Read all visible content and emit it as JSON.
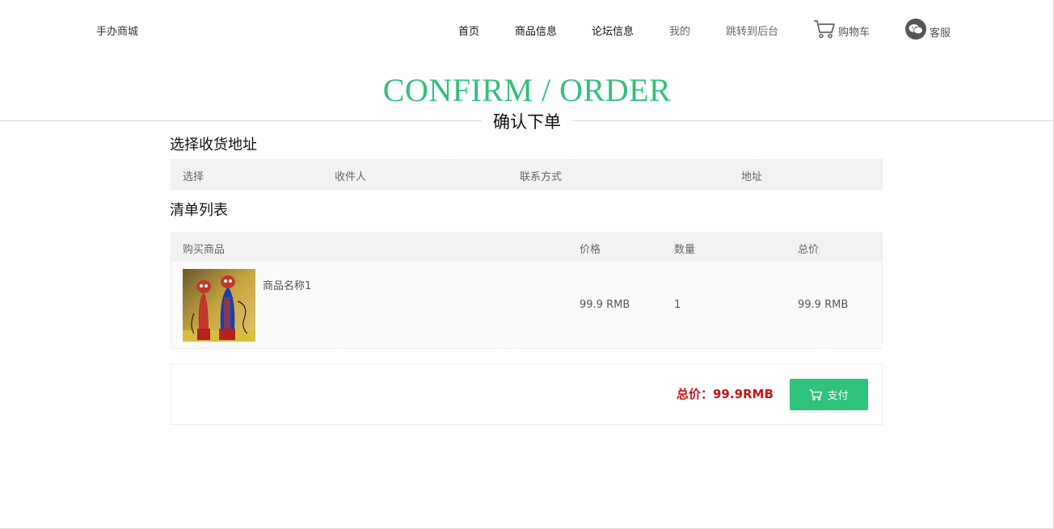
{
  "header": {
    "logo": "手办商城",
    "nav": [
      "首页",
      "商品信息",
      "论坛信息",
      "我的",
      "跳转到后台"
    ],
    "cart_label": "购物车",
    "service_label": "客服"
  },
  "title": {
    "en": "CONFIRM / ORDER",
    "cn": "确认下单"
  },
  "address_section": {
    "title": "选择收货地址",
    "columns": [
      "选择",
      "收件人",
      "联系方式",
      "地址"
    ]
  },
  "list_section": {
    "title": "清单列表",
    "columns": [
      "购买商品",
      "价格",
      "数量",
      "总价"
    ],
    "items": [
      {
        "name": "商品名称1",
        "price": "99.9 RMB",
        "qty": "1",
        "total": "99.9 RMB"
      }
    ]
  },
  "footer": {
    "total": "总价：99.9RMB",
    "pay_label": "支付"
  },
  "colors": {
    "accent": "#2ec27a",
    "price": "#c81419",
    "title": "#32c07a"
  },
  "icons": [
    "cart-icon",
    "wechat-icon"
  ]
}
